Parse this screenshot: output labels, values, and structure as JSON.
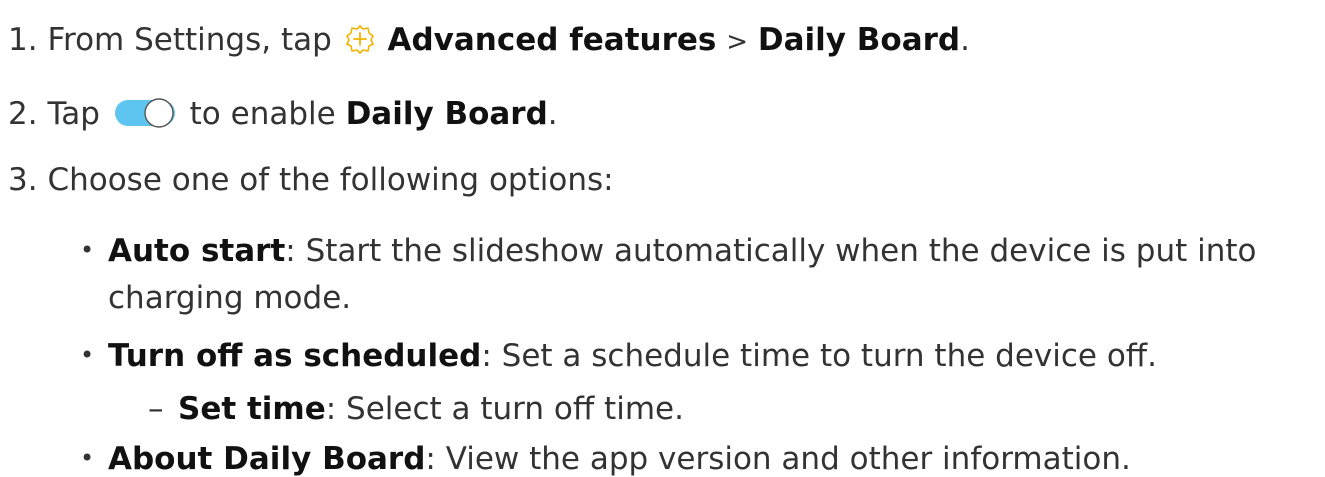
{
  "steps": [
    {
      "number": "1.",
      "prefix": "From Settings, tap",
      "icon": "advanced-features-gear-icon",
      "bold1": "Advanced features",
      "separator": ">",
      "bold2": "Daily Board",
      "suffix": "."
    },
    {
      "number": "2.",
      "prefix": "Tap",
      "icon": "toggle-switch-icon",
      "middle": "to enable",
      "bold1": "Daily Board",
      "suffix": "."
    },
    {
      "number": "3.",
      "text": "Choose one of the following options:"
    }
  ],
  "options": [
    {
      "bullet": "•",
      "term": "Auto start",
      "desc_line1": ": Start the slideshow automatically when the device is put into",
      "desc_line2": "charging mode."
    },
    {
      "bullet": "•",
      "term": "Turn off as scheduled",
      "desc": ": Set a schedule time to turn the device off.",
      "sub": {
        "dash": "–",
        "term": "Set time",
        "desc": ": Select a turn off time."
      }
    },
    {
      "bullet": "•",
      "term": "About Daily Board",
      "desc": ": View the app version and other information."
    }
  ],
  "colors": {
    "text": "#333333",
    "toggle_track": "#5ec4f0",
    "icon_gold": "#f0b400"
  }
}
